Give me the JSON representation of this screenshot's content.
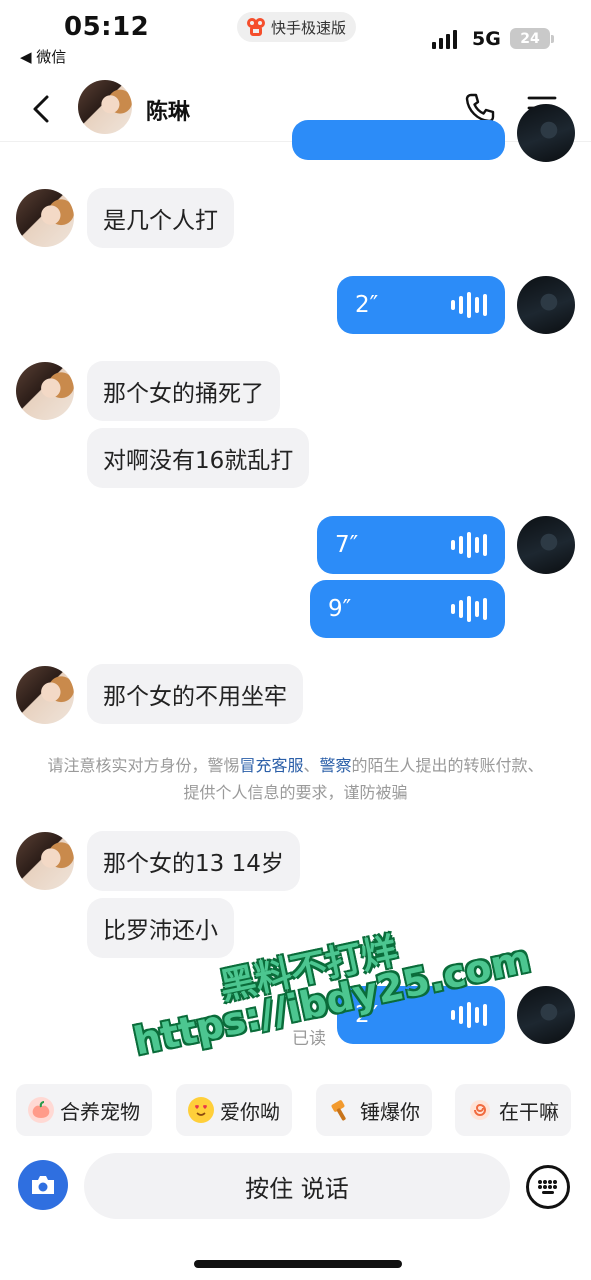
{
  "status_bar": {
    "time": "05:12",
    "back_app": "◀ 微信",
    "center_app": "快手极速版",
    "network": "5G",
    "battery": "24"
  },
  "header": {
    "title": "陈琳"
  },
  "messages": {
    "m1": "是几个人打",
    "v1": "2″",
    "m2": "那个女的捅死了",
    "m3": "对啊没有16就乱打",
    "v2": "7″",
    "v3": "9″",
    "m4": "那个女的不用坐牢",
    "m5": "那个女的13 14岁",
    "m6": "比罗沛还小",
    "v4": "2″",
    "read_status": "已读"
  },
  "notice": {
    "p1": "请注意核实对方身份，警惕",
    "h1": "冒充客服",
    "p2": "、",
    "h2": "警察",
    "p3": "的陌生人提出的转账付款、提供个人信息的要求，谨防被骗"
  },
  "watermark": {
    "line1": "黑料不打烊",
    "line2": "https://ibdy25.com"
  },
  "quick_replies": [
    {
      "label": "合养宠物",
      "icon": "peach-icon"
    },
    {
      "label": "爱你呦",
      "icon": "love-face-icon"
    },
    {
      "label": "锤爆你",
      "icon": "hammer-icon"
    },
    {
      "label": "在干嘛",
      "icon": "swirl-icon"
    }
  ],
  "input": {
    "hold_to_talk": "按住 说话"
  },
  "colors": {
    "voice_bubble": "#2c8cf8",
    "camera": "#2f6fe0",
    "incoming_bubble": "#f2f2f4"
  }
}
